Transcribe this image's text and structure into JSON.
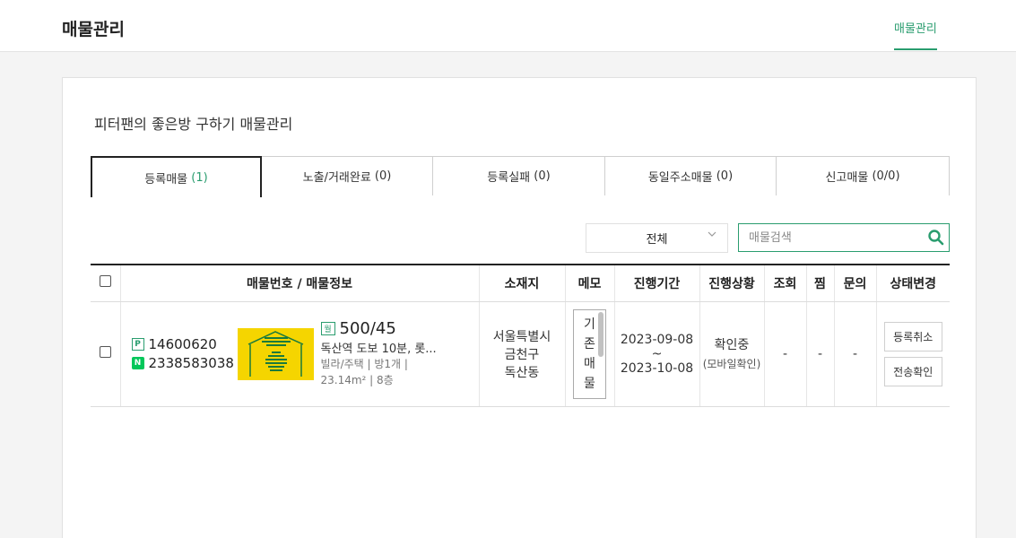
{
  "header": {
    "title": "매물관리",
    "nav_item": "매물관리"
  },
  "page": {
    "subtitle": "피터팬의 좋은방 구하기 매물관리"
  },
  "tabs": [
    {
      "label": "등록매물",
      "count": "(1)"
    },
    {
      "label": "노출/거래완료",
      "count": "(0)"
    },
    {
      "label": "등록실패",
      "count": "(0)"
    },
    {
      "label": "동일주소매물",
      "count": "(0)"
    },
    {
      "label": "신고매물",
      "count": "(0/0)"
    }
  ],
  "filter": {
    "selected": "전체"
  },
  "search": {
    "placeholder": "매물검색",
    "value": ""
  },
  "table": {
    "headers": [
      "매물번호 / 매물정보",
      "소재지",
      "메모",
      "진행기간",
      "진행상황",
      "조회",
      "찜",
      "문의",
      "상태변경"
    ],
    "rows": [
      {
        "p_number": "14600620",
        "n_number": "2338583038",
        "price_badge": "월",
        "price": "500/45",
        "title": "독산역 도보 10분, 롯...",
        "meta_line1": "빌라/주택 | 방1개 |",
        "meta_line2": "23.14m² | 8층",
        "loc_line1": "서울특별시",
        "loc_line2": "금천구",
        "loc_line3": "독산동",
        "memo": "기존매물",
        "period_start": "2023-09-08",
        "period_sep": "~",
        "period_end": "2023-10-08",
        "status_main": "확인중",
        "status_sub": "(모바일확인)",
        "views": "-",
        "likes": "-",
        "inquiries": "-",
        "btn_cancel": "등록취소",
        "btn_confirm": "전송확인"
      }
    ]
  },
  "badges": {
    "p": "P",
    "n": "N"
  },
  "colors": {
    "accent": "#2a9d6f",
    "naver": "#03c75a",
    "thumb": "#f5d500"
  }
}
